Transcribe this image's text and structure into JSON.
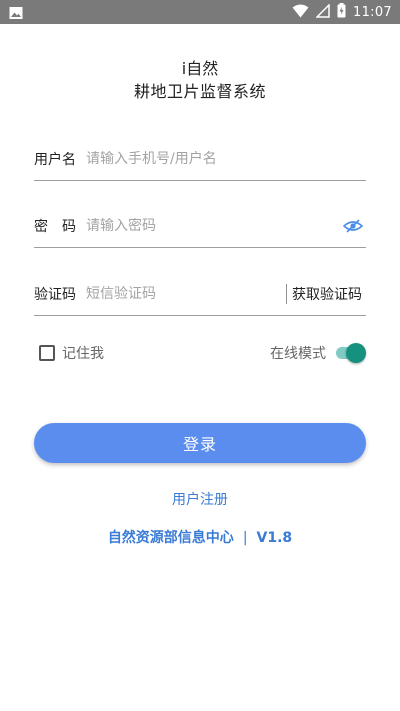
{
  "status_bar": {
    "time": "11:07",
    "icons": [
      "image-icon",
      "wifi-icon",
      "signal-icon",
      "battery-charging-icon"
    ]
  },
  "header": {
    "app_name": "i自然",
    "subtitle": "耕地卫片监督系统"
  },
  "form": {
    "username": {
      "label": "用户名",
      "placeholder": "请输入手机号/用户名",
      "value": ""
    },
    "password": {
      "label": "密　码",
      "placeholder": "请输入密码",
      "value": ""
    },
    "captcha": {
      "label": "验证码",
      "placeholder": "短信验证码",
      "value": "",
      "button_label": "获取验证码"
    }
  },
  "options": {
    "remember_label": "记住我",
    "remember_checked": false,
    "online_label": "在线模式",
    "online_enabled": true
  },
  "actions": {
    "login_label": "登录",
    "register_label": "用户注册"
  },
  "footer": {
    "org": "自然资源部信息中心",
    "separator": "|",
    "version": "V1.8"
  },
  "colors": {
    "primary": "#5b8def",
    "link": "#3a7bd5",
    "toggle_thumb": "#17917f",
    "toggle_track": "#80cbc4",
    "status_bar": "#7a7a7a"
  }
}
